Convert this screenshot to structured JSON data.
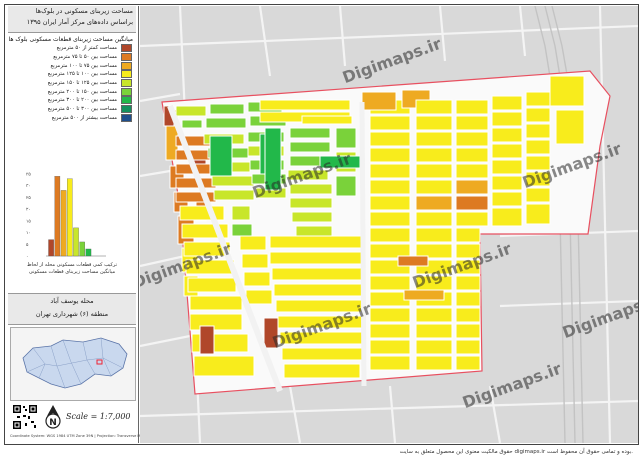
{
  "title": {
    "line1": "مساحت زیربنای مسکونی در بلوک‌ها",
    "line2": "براساس داده‌های مرکز آمار ایران ۱۳۹۵"
  },
  "legend": {
    "title": "میانگین مساحت زیربنای قطعات مسکونی بلوک ها",
    "items": [
      {
        "label": "مساحت کمتر از ۵۰ مترمربع",
        "color": "#b0472a"
      },
      {
        "label": "مساحت بین ۵۰ تا ۷۵ مترمربع",
        "color": "#dd7a22"
      },
      {
        "label": "مساحت بین ۷۵ تا ۱۰۰ مترمربع",
        "color": "#eeaa22"
      },
      {
        "label": "مساحت بین ۱۰۰ تا ۱۲۵ مترمربع",
        "color": "#f8ec1c"
      },
      {
        "label": "مساحت بین ۱۲۵ تا ۱۵۰ مترمربع",
        "color": "#c8e62a"
      },
      {
        "label": "مساحت بین ۱۵۰ تا ۲۰۰ مترمربع",
        "color": "#7ad23a"
      },
      {
        "label": "مساحت بین ۲۰۰ تا ۳۰۰ مترمربع",
        "color": "#22b84a"
      },
      {
        "label": "مساحت بین ۳۰۰ تا ۵۰۰ مترمربع",
        "color": "#14905e"
      },
      {
        "label": "مساحت بیشتر از ۵۰۰ مترمربع",
        "color": "#1e4e8c"
      }
    ]
  },
  "chart_data": {
    "type": "bar",
    "categories": [
      "<50",
      "50-75",
      "75-100",
      "100-125",
      "125-150",
      "150-200",
      "200-300",
      "300-500",
      ">500"
    ],
    "values": [
      7,
      34,
      28,
      33,
      12,
      6,
      3,
      0,
      0
    ],
    "colors": [
      "#b0472a",
      "#dd7a22",
      "#eeaa22",
      "#f8ec1c",
      "#c8e62a",
      "#7ad23a",
      "#22b84a",
      "#14905e",
      "#1e4e8c"
    ],
    "yticks": [
      "۳۵",
      "۳۰",
      "۲۵",
      "۲۰",
      "۱۵",
      "۱۰",
      "۵",
      "۰"
    ],
    "ylim": [
      0,
      35
    ],
    "caption1": "ترکیب کمی قطعات مسکونی محله از لحاظ",
    "caption2": "میانگین مساحت زیربنای قطعات مسکونی"
  },
  "info": {
    "neighborhood": "محله یوسف آباد",
    "district": "منطقه (۶) شهرداری تهران"
  },
  "scale": "Scale = 1:7,000",
  "north_label": "N",
  "coord_system": "Coordinate System: WGS 1984 UTM Zone 39N | Projection: Transverse Mercator",
  "footer": "حقوق مالکیت معنوی این محصول متعلق به سایت digimaps.ir بوده و تمامی حقوق آن محفوظ است.",
  "watermark": "Digimaps.ir"
}
